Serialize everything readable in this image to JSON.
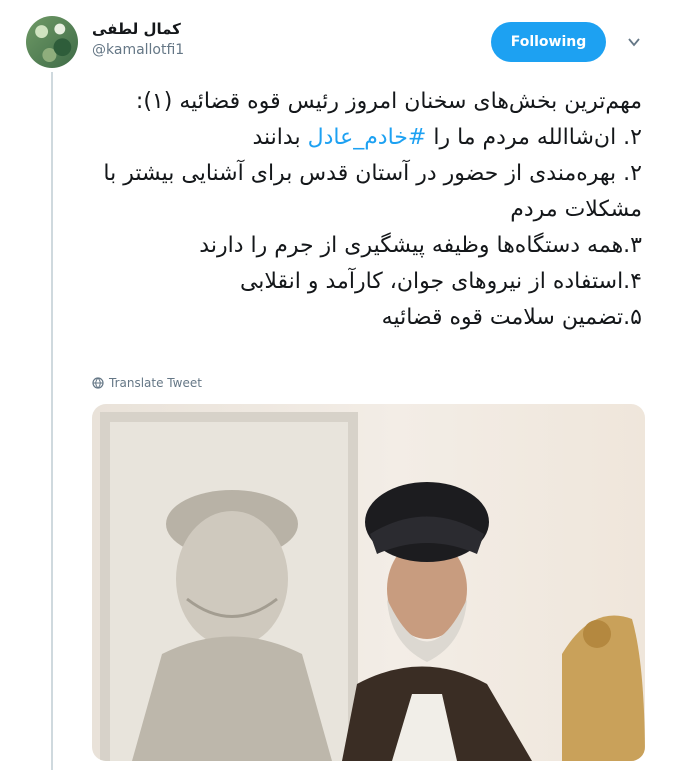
{
  "user": {
    "name": "کمال لطفی",
    "handle": "@kamallotfi1"
  },
  "follow_button": {
    "label": "Following"
  },
  "tweet": {
    "lines": [
      "مهم‌ترین بخش‌های سخنان امروز رئیس قوه قضائیه (۱):",
      "۲. بهره‌مندی از حضور در آستان قدس برای آشنایی بیشتر با مشکلات مردم",
      "۳.همه دستگاه‌ها وظیفه پیشگیری از جرم را دارند",
      "۴.استفاده از نیروهای جوان، کارآمد و انقلابی",
      "۵.تضمین سلامت قوه قضائیه"
    ],
    "line2": {
      "prefix": "۲. ان‌شاالله مردم ما را ",
      "hashtag": "#خادم_عادل",
      "suffix": " بدانند"
    }
  },
  "translate_label": "Translate Tweet",
  "colors": {
    "accent": "#1da1f2",
    "muted": "#657786",
    "thread_line": "#cfd9de"
  },
  "icons": [
    "caret-down-icon",
    "globe-icon"
  ]
}
